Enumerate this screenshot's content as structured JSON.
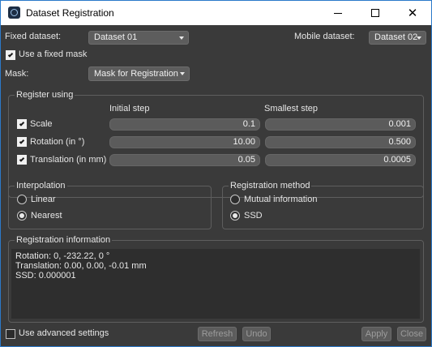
{
  "window": {
    "title": "Dataset Registration",
    "minimize_label": "minimize",
    "maximize_label": "maximize",
    "close_label": "close"
  },
  "fixed_dataset": {
    "label": "Fixed dataset:",
    "value": "Dataset 01"
  },
  "mobile_dataset": {
    "label": "Mobile dataset:",
    "value": "Dataset 02"
  },
  "use_fixed_mask": {
    "label": "Use a fixed mask",
    "checked": true
  },
  "mask": {
    "label": "Mask:",
    "value": "Mask for Registration"
  },
  "register_using": {
    "title": "Register using",
    "col_initial": "Initial step",
    "col_smallest": "Smallest step",
    "rows": [
      {
        "label": "Scale",
        "checked": true,
        "initial": "0.1",
        "smallest": "0.001"
      },
      {
        "label": "Rotation (in °)",
        "checked": true,
        "initial": "10.00",
        "smallest": "0.500"
      },
      {
        "label": "Translation (in mm)",
        "checked": true,
        "initial": "0.05",
        "smallest": "0.0005"
      }
    ]
  },
  "interpolation": {
    "title": "Interpolation",
    "options": [
      {
        "label": "Linear",
        "selected": false
      },
      {
        "label": "Nearest",
        "selected": true
      }
    ]
  },
  "registration_method": {
    "title": "Registration method",
    "options": [
      {
        "label": "Mutual information",
        "selected": false
      },
      {
        "label": "SSD",
        "selected": true
      }
    ]
  },
  "registration_information": {
    "title": "Registration information",
    "lines": [
      "Rotation: 0, -232.22, 0 °",
      "Translation: 0.00, 0.00, -0.01 mm",
      "",
      "SSD: 0.000001"
    ]
  },
  "footer": {
    "advanced_label": "Use advanced settings",
    "advanced_checked": false,
    "refresh_label": "Refresh",
    "undo_label": "Undo",
    "apply_label": "Apply",
    "close_label": "Close"
  }
}
